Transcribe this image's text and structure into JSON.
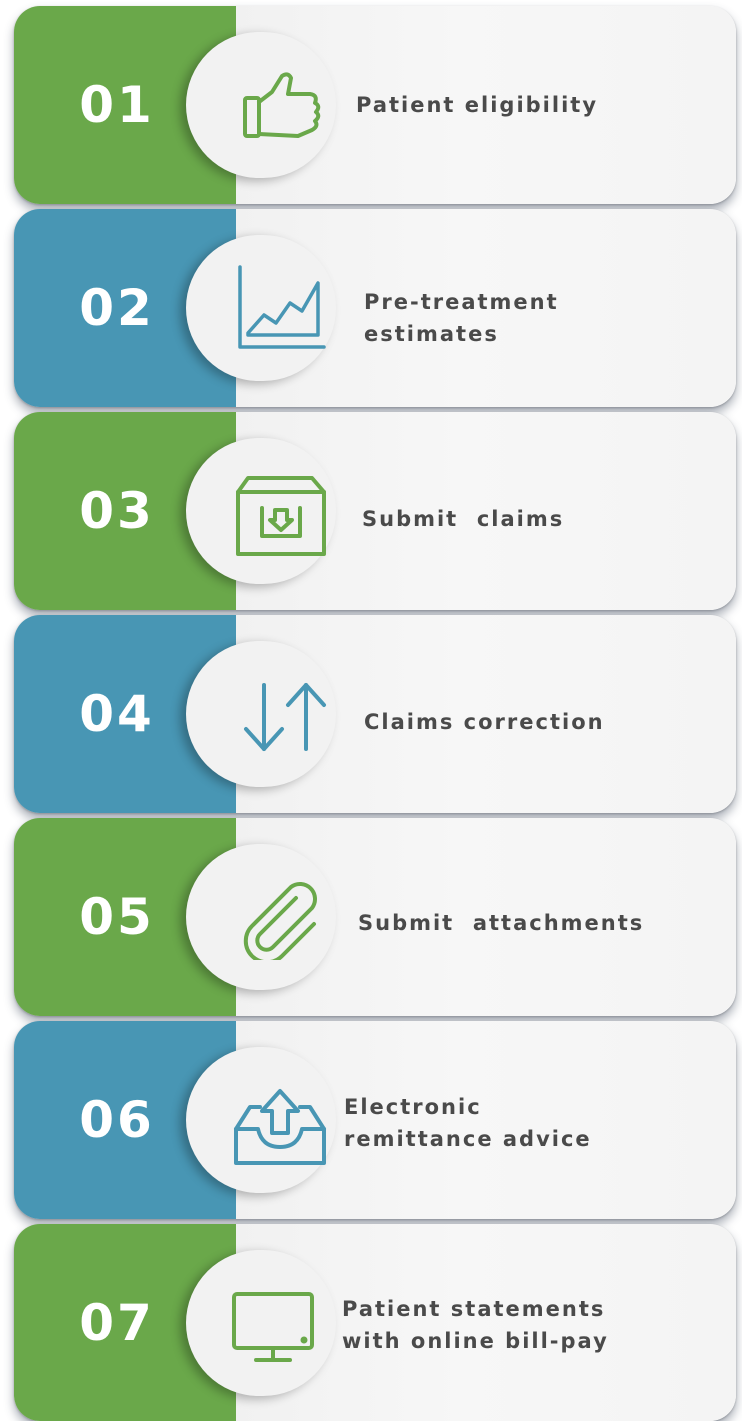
{
  "steps": [
    {
      "number": "01",
      "label": "Patient eligibility",
      "icon": "thumbs-up-icon",
      "color": "green"
    },
    {
      "number": "02",
      "label": "Pre-treatment\nestimates",
      "icon": "growth-chart-icon",
      "color": "blue"
    },
    {
      "number": "03",
      "label": "Submit  claims",
      "icon": "inbox-download-icon",
      "color": "green"
    },
    {
      "number": "04",
      "label": "Claims correction",
      "icon": "up-down-arrows-icon",
      "color": "blue"
    },
    {
      "number": "05",
      "label": "Submit  attachments",
      "icon": "paperclip-icon",
      "color": "green"
    },
    {
      "number": "06",
      "label": "Electronic\nremittance advice",
      "icon": "tray-upload-icon",
      "color": "blue"
    },
    {
      "number": "07",
      "label": "Patient statements\nwith online bill-pay",
      "icon": "monitor-icon",
      "color": "green"
    }
  ],
  "colors": {
    "green": "#6aa84a",
    "blue": "#4896b4",
    "text": "#4a4a4a"
  }
}
